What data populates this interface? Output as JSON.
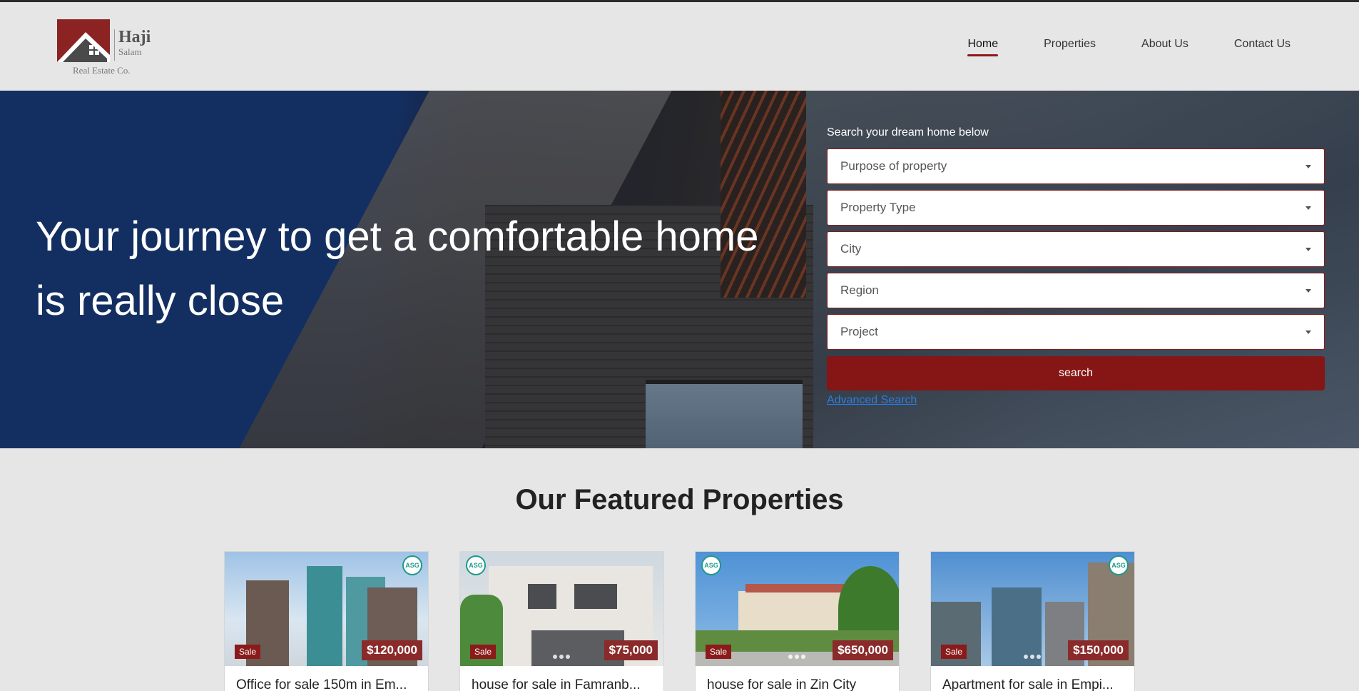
{
  "brand": {
    "name": "Haji",
    "sub": "Salam",
    "tagline": "Real Estate Co."
  },
  "nav": {
    "items": [
      {
        "label": "Home",
        "active": true
      },
      {
        "label": "Properties",
        "active": false
      },
      {
        "label": "About Us",
        "active": false
      },
      {
        "label": "Contact Us",
        "active": false
      }
    ]
  },
  "hero": {
    "title_line1": "Your journey to get a comfortable home",
    "title_line2": "is really close"
  },
  "search": {
    "heading": "Search your dream home below",
    "fields": [
      {
        "placeholder": "Purpose of property"
      },
      {
        "placeholder": "Property Type"
      },
      {
        "placeholder": "City"
      },
      {
        "placeholder": "Region"
      },
      {
        "placeholder": "Project"
      }
    ],
    "button_label": "search",
    "advanced_link": "Advanced Search"
  },
  "featured": {
    "title": "Our Featured Properties",
    "cards": [
      {
        "title": "Office for sale 150m in Em...",
        "tag": "Sale",
        "price": "$120,000",
        "logo": "ASG"
      },
      {
        "title": "house for sale in Famranb...",
        "tag": "Sale",
        "price": "$75,000",
        "logo": "ASG"
      },
      {
        "title": "house for sale in Zin City",
        "tag": "Sale",
        "price": "$650,000",
        "logo": "ASG"
      },
      {
        "title": "Apartment for sale in Empi...",
        "tag": "Sale",
        "price": "$150,000",
        "logo": "ASG"
      }
    ]
  },
  "colors": {
    "accent": "#8b1a1a",
    "link": "#2a7de1",
    "hero_blue": "#15336a"
  }
}
